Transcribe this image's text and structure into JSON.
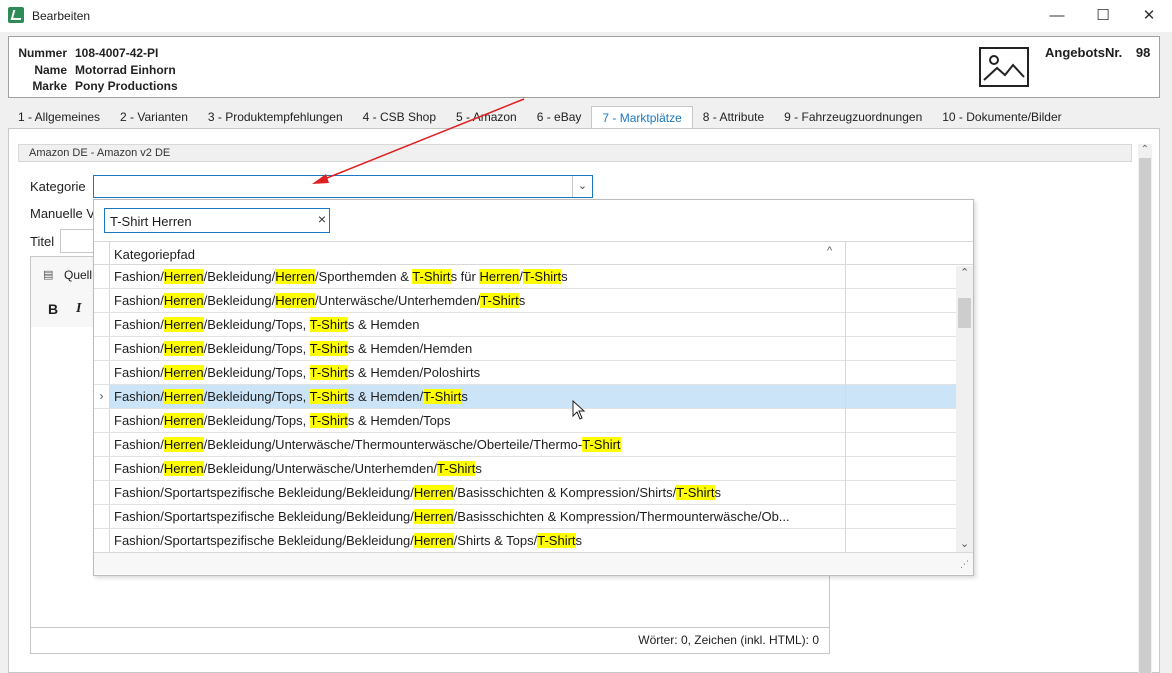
{
  "window": {
    "title": "Bearbeiten",
    "minimize_icon": "minimize-icon",
    "maximize_icon": "maximize-icon",
    "close_icon": "close-icon"
  },
  "header": {
    "nummer_label": "Nummer",
    "nummer_value": "108-4007-42-PI",
    "name_label": "Name",
    "name_value": "Motorrad Einhorn",
    "marke_label": "Marke",
    "marke_value": "Pony Productions",
    "angebots_label": "AngebotsNr.",
    "angebots_value": "98"
  },
  "tabs": [
    {
      "label": "1 - Allgemeines",
      "active": false
    },
    {
      "label": "2 - Varianten",
      "active": false
    },
    {
      "label": "3 - Produktempfehlungen",
      "active": false
    },
    {
      "label": "4 - CSB Shop",
      "active": false
    },
    {
      "label": "5 - Amazon",
      "active": false
    },
    {
      "label": "6 - eBay",
      "active": false
    },
    {
      "label": "7 - Marktplätze",
      "active": true
    },
    {
      "label": "8 - Attribute",
      "active": false
    },
    {
      "label": "9 - Fahrzeugzuordnungen",
      "active": false
    },
    {
      "label": "10 - Dokumente/Bilder",
      "active": false
    }
  ],
  "group": {
    "title": "Amazon DE - Amazon v2 DE"
  },
  "form": {
    "kategorie_label": "Kategorie",
    "kategorie_value": "",
    "manuelle_label": "Manuelle V",
    "titel_label": "Titel"
  },
  "editor": {
    "source_label": "Quell",
    "bold_label": "B",
    "italic_label": "I",
    "status": "Wörter: 0, Zeichen (inkl. HTML): 0"
  },
  "popup": {
    "search_value": "T-Shirt Herren",
    "clear_label": "×",
    "column_header": "Kategoriepfad",
    "sort_icon": "chevron-up-icon",
    "rows": [
      {
        "text": "Fashion/Herren/Bekleidung/Herren/Sporthemden & T-Shirts für Herren/T-Shirts",
        "selected": false
      },
      {
        "text": "Fashion/Herren/Bekleidung/Herren/Unterwäsche/Unterhemden/T-Shirts",
        "selected": false
      },
      {
        "text": "Fashion/Herren/Bekleidung/Tops, T-Shirts & Hemden",
        "selected": false
      },
      {
        "text": "Fashion/Herren/Bekleidung/Tops, T-Shirts & Hemden/Hemden",
        "selected": false
      },
      {
        "text": "Fashion/Herren/Bekleidung/Tops, T-Shirts & Hemden/Poloshirts",
        "selected": false
      },
      {
        "text": "Fashion/Herren/Bekleidung/Tops, T-Shirts & Hemden/T-Shirts",
        "selected": true
      },
      {
        "text": "Fashion/Herren/Bekleidung/Tops, T-Shirts & Hemden/Tops",
        "selected": false
      },
      {
        "text": "Fashion/Herren/Bekleidung/Unterwäsche/Thermounterwäsche/Oberteile/Thermo-T-Shirt",
        "selected": false
      },
      {
        "text": "Fashion/Herren/Bekleidung/Unterwäsche/Unterhemden/T-Shirts",
        "selected": false
      },
      {
        "text": "Fashion/Sportartspezifische Bekleidung/Bekleidung/Herren/Basisschichten & Kompression/Shirts/T-Shirts",
        "selected": false
      },
      {
        "text": "Fashion/Sportartspezifische Bekleidung/Bekleidung/Herren/Basisschichten & Kompression/Thermounterwäsche/Ob...",
        "selected": false
      },
      {
        "text": "Fashion/Sportartspezifische Bekleidung/Bekleidung/Herren/Shirts & Tops/T-Shirts",
        "selected": false
      }
    ],
    "highlight_terms": [
      "Herren",
      "T-Shirt"
    ],
    "highlight_color": "#ffff00",
    "selected_row_color": "#cce4f7"
  },
  "colors": {
    "accent": "#1a78c2",
    "arrow": "#e02020"
  }
}
